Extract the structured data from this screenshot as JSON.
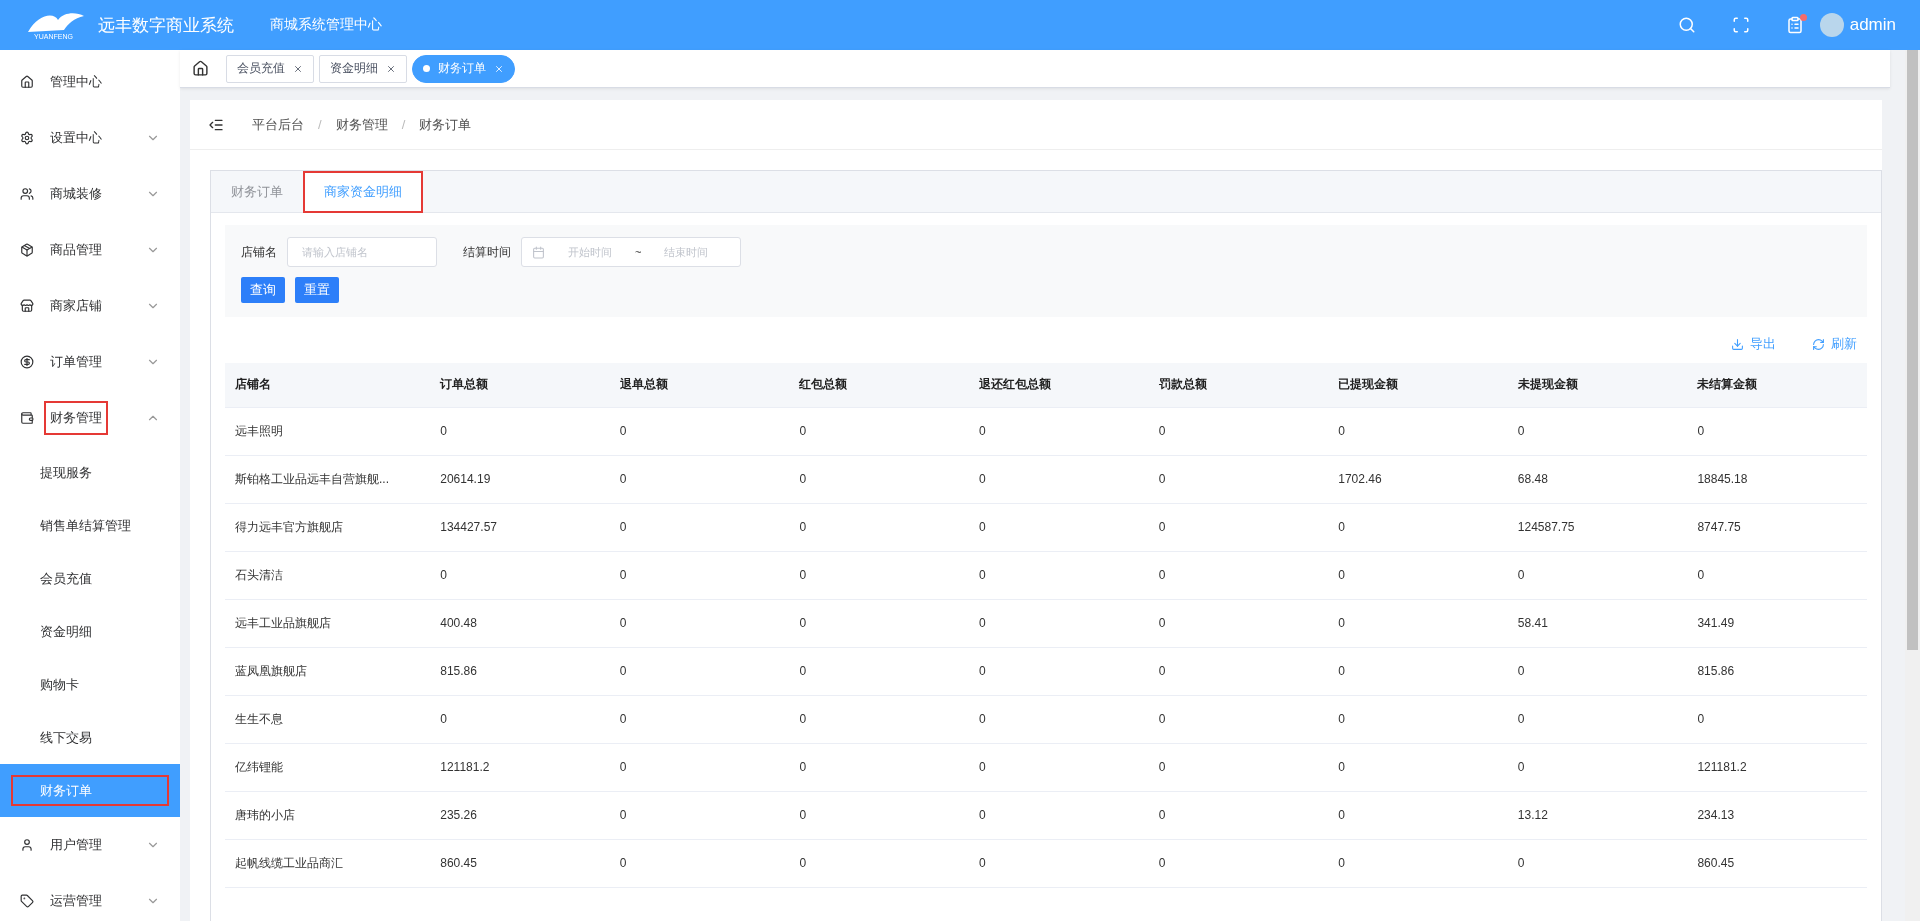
{
  "header": {
    "app_name": "远丰数字商业系统",
    "logo_text": "YUANFENG",
    "subtitle": "商城系统管理中心",
    "notification": true,
    "user": "admin"
  },
  "sidebar": {
    "items": [
      {
        "label": "管理中心",
        "selected": false,
        "highlighted": false
      },
      {
        "label": "设置中心",
        "expanded": false,
        "selected": false,
        "highlighted": false
      },
      {
        "label": "商城装修",
        "expanded": false,
        "selected": false,
        "highlighted": false
      },
      {
        "label": "商品管理",
        "expanded": false,
        "selected": false,
        "highlighted": false
      },
      {
        "label": "商家店铺",
        "expanded": false,
        "selected": false,
        "highlighted": false
      },
      {
        "label": "订单管理",
        "expanded": false,
        "selected": false,
        "highlighted": false
      },
      {
        "label": "财务管理",
        "expanded": true,
        "selected": false,
        "highlighted": true,
        "children": [
          {
            "label": "提现服务",
            "selected": false,
            "highlighted": false
          },
          {
            "label": "销售单结算管理",
            "selected": false,
            "highlighted": false
          },
          {
            "label": "会员充值",
            "selected": false,
            "highlighted": false
          },
          {
            "label": "资金明细",
            "selected": false,
            "highlighted": false
          },
          {
            "label": "购物卡",
            "selected": false,
            "highlighted": false
          },
          {
            "label": "线下交易",
            "selected": false,
            "highlighted": false
          },
          {
            "label": "财务订单",
            "selected": true,
            "highlighted": true
          }
        ]
      },
      {
        "label": "用户管理",
        "expanded": false,
        "selected": false,
        "highlighted": false
      },
      {
        "label": "运营管理",
        "expanded": false,
        "selected": false,
        "highlighted": false
      }
    ]
  },
  "page_tabs": [
    {
      "label": "会员充值",
      "selected": false
    },
    {
      "label": "资金明细",
      "selected": false
    },
    {
      "label": "财务订单",
      "selected": true
    }
  ],
  "breadcrumb": {
    "separator": "/",
    "items": [
      "平台后台",
      "财务管理",
      "财务订单"
    ]
  },
  "card_tabs": [
    {
      "label": "财务订单",
      "selected": false,
      "highlighted": false
    },
    {
      "label": "商家资金明细",
      "selected": true,
      "highlighted": true
    }
  ],
  "filters": {
    "shop": {
      "label": "店铺名",
      "placeholder": "请输入店铺名"
    },
    "date_range": {
      "label": "结算时间",
      "start_placeholder": "开始时间",
      "separator": "~",
      "end_placeholder": "结束时间"
    },
    "buttons": [
      "查询",
      "重置"
    ]
  },
  "actions": [
    "导出",
    "刷新"
  ],
  "table": {
    "columns": [
      "店铺名",
      "订单总额",
      "退单总额",
      "红包总额",
      "退还红包总额",
      "罚款总额",
      "已提现金额",
      "未提现金额",
      "未结算金额"
    ],
    "rows": [
      [
        "远丰照明",
        "0",
        "0",
        "0",
        "0",
        "0",
        "0",
        "0",
        "0"
      ],
      [
        "斯铂格工业品远丰自营旗舰...",
        "20614.19",
        "0",
        "0",
        "0",
        "0",
        "1702.46",
        "68.48",
        "18845.18"
      ],
      [
        "得力远丰官方旗舰店",
        "134427.57",
        "0",
        "0",
        "0",
        "0",
        "0",
        "124587.75",
        "8747.75"
      ],
      [
        "石头清洁",
        "0",
        "0",
        "0",
        "0",
        "0",
        "0",
        "0",
        "0"
      ],
      [
        "远丰工业品旗舰店",
        "400.48",
        "0",
        "0",
        "0",
        "0",
        "0",
        "58.41",
        "341.49"
      ],
      [
        "蓝凤凰旗舰店",
        "815.86",
        "0",
        "0",
        "0",
        "0",
        "0",
        "0",
        "815.86"
      ],
      [
        "生生不息",
        "0",
        "0",
        "0",
        "0",
        "0",
        "0",
        "0",
        "0"
      ],
      [
        "亿纬锂能",
        "121181.2",
        "0",
        "0",
        "0",
        "0",
        "0",
        "0",
        "121181.2"
      ],
      [
        "唐玮的小店",
        "235.26",
        "0",
        "0",
        "0",
        "0",
        "0",
        "13.12",
        "234.13"
      ],
      [
        "起帆线缆工业品商汇",
        "860.45",
        "0",
        "0",
        "0",
        "0",
        "0",
        "0",
        "860.45"
      ]
    ]
  }
}
